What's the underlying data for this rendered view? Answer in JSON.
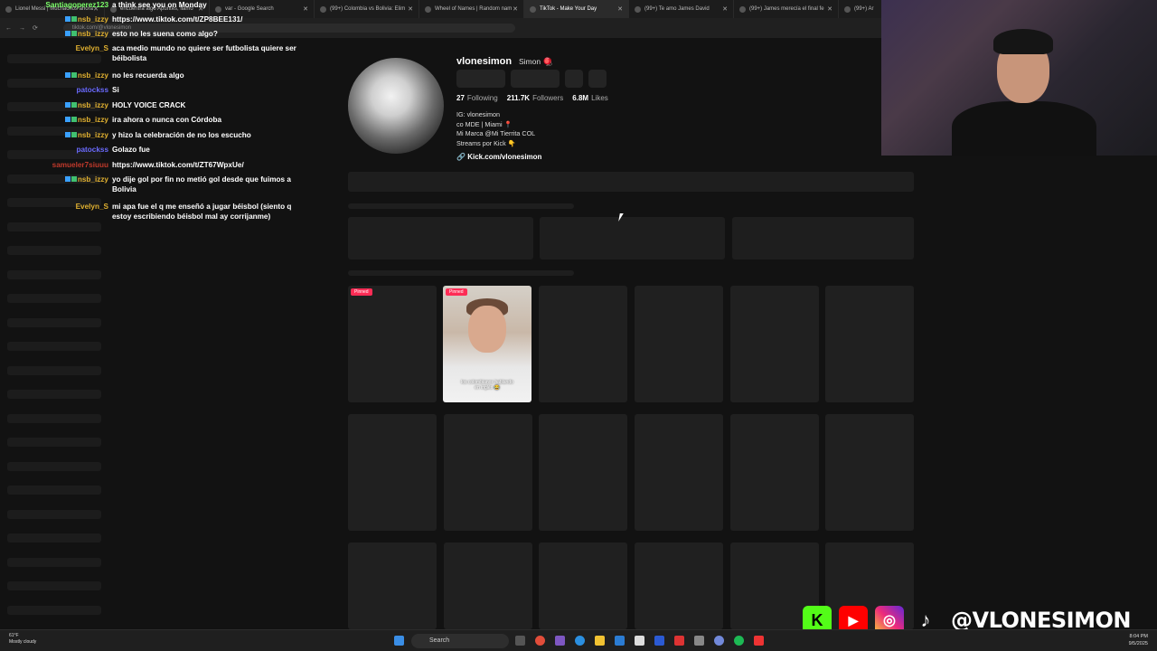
{
  "browser": {
    "tabs": [
      {
        "label": "Lionel Messi | Muchachos ahora",
        "active": false
      },
      {
        "label": "encuentra algo Apuntes, llamo",
        "active": false
      },
      {
        "label": "var - Google Search",
        "active": false
      },
      {
        "label": "(99+) Colombia vs Bolivia: Elim",
        "active": false
      },
      {
        "label": "Wheel of Names | Random nam",
        "active": false
      },
      {
        "label": "TikTok - Make Your Day",
        "active": true
      },
      {
        "label": "(99+) Te amo James David",
        "active": false
      },
      {
        "label": "(99+) James merecía el final fe",
        "active": false
      },
      {
        "label": "(99+) Ar",
        "active": false
      }
    ],
    "url": "tiktok.com/@vlonesimon"
  },
  "chat": [
    {
      "name": "Santiagoperez123",
      "color": "#7cff6a",
      "text": "a think see you on Monday",
      "badge": false
    },
    {
      "name": "nsb_izzy",
      "color": "#e0b030",
      "text": "https://www.tiktok.com/t/ZP8BEE131/",
      "badge": true
    },
    {
      "name": "nsb_izzy",
      "color": "#e0b030",
      "text": "esto no les suena como algo?",
      "badge": true
    },
    {
      "name": "Evelyn_S",
      "color": "#e0b030",
      "text": "aca medio mundo no quiere ser futbolista quiere ser béibolista",
      "badge": false
    },
    {
      "name": "nsb_izzy",
      "color": "#e0b030",
      "text": "no les recuerda algo",
      "badge": true
    },
    {
      "name": "patockss",
      "color": "#6b6bff",
      "text": "Si",
      "badge": false
    },
    {
      "name": "nsb_izzy",
      "color": "#e0b030",
      "text": "HOLY VOICE CRACK",
      "badge": true
    },
    {
      "name": "nsb_izzy",
      "color": "#e0b030",
      "text": "ira ahora o nunca con Córdoba",
      "badge": true
    },
    {
      "name": "nsb_izzy",
      "color": "#e0b030",
      "text": "y hizo la celebración de no los escucho",
      "badge": true
    },
    {
      "name": "patockss",
      "color": "#6b6bff",
      "text": "Golazo fue",
      "badge": false
    },
    {
      "name": "samueler7siuuu",
      "color": "#c0392b",
      "text": "https://www.tiktok.com/t/ZT67WpxUe/",
      "badge": false
    },
    {
      "name": "nsb_izzy",
      "color": "#e0b030",
      "text": "yo dije gol por fin no metió gol desde que fuimos a Bolivia",
      "badge": true
    },
    {
      "name": "Evelyn_S",
      "color": "#e0b030",
      "text": "mi apa fue el q me enseñó a jugar béisbol (siento q estoy escribiendo béisbol mal ay corrijanme)",
      "badge": false
    }
  ],
  "profile": {
    "username": "vlonesimon",
    "display_name": "Simon 🪀",
    "following_count": "27",
    "following_label": "Following",
    "followers_count": "211.7K",
    "followers_label": "Followers",
    "likes_count": "6.8M",
    "likes_label": "Likes",
    "bio": [
      "IG: vlonesimon",
      "co MDE | Miami 📍",
      "Mi Marca @Mi Tierrita COL",
      "Streams por Kick 👇"
    ],
    "link": "Kick.com/vlonesimon"
  },
  "videos": {
    "pinned_label": "Pinned",
    "caption": "los colombianos hablando en inglés 😂"
  },
  "overlay": {
    "handle": "@VLONESIMON",
    "icons": [
      "kick-icon",
      "youtube-icon",
      "instagram-icon",
      "tiktok-icon"
    ]
  },
  "taskbar": {
    "temp": "61°F",
    "weather": "Mostly cloudy",
    "search": "Search",
    "time": "8:04 PM",
    "date": "9/5/2025"
  },
  "colors": {
    "tiktok_red": "#fe2c55",
    "kick_green": "#53fc18",
    "youtube_red": "#ff0000"
  }
}
